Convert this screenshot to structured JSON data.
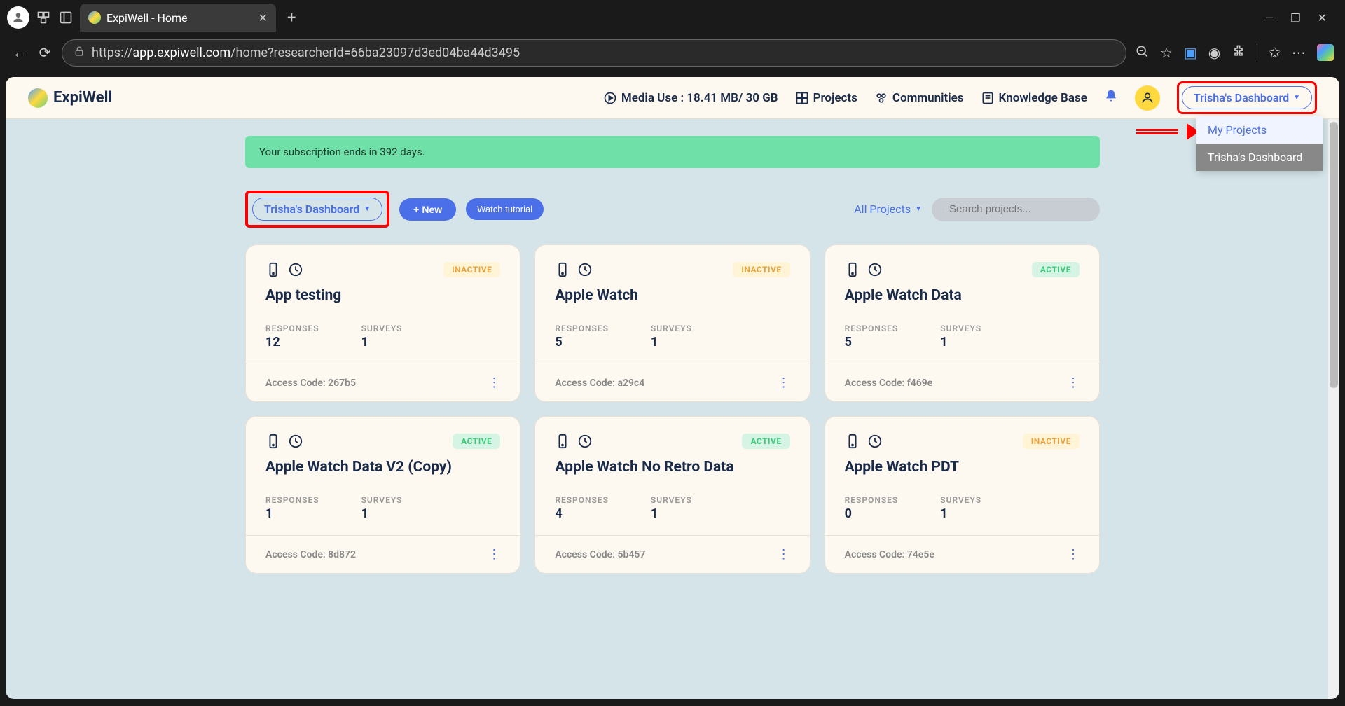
{
  "browser": {
    "tab_title": "ExpiWell - Home",
    "url_prefix": "https://",
    "url_domain": "app.expiwell.com",
    "url_path": "/home?researcherId=66ba23097d3ed04ba44d3495"
  },
  "header": {
    "logo_text": "ExpiWell",
    "media_use": "Media Use : 18.41 MB/ 30 GB",
    "nav_projects": "Projects",
    "nav_communities": "Communities",
    "nav_knowledge": "Knowledge Base",
    "dashboard_label": "Trisha's Dashboard"
  },
  "dropdown": {
    "item_myprojects": "My Projects",
    "item_dashboard": "Trisha's Dashboard"
  },
  "banner": {
    "subscription_text": "Your subscription ends in 392 days."
  },
  "controls": {
    "dashboard_label": "Trisha's Dashboard",
    "new_btn": "New",
    "tutorial_btn": "Watch tutorial",
    "filter_label": "All Projects",
    "search_placeholder": "Search projects..."
  },
  "labels": {
    "responses": "RESPONSES",
    "surveys": "SURVEYS",
    "access_code_prefix": "Access Code: ",
    "status_active": "ACTIVE",
    "status_inactive": "INACTIVE"
  },
  "projects": [
    {
      "title": "App testing",
      "status": "INACTIVE",
      "responses": "12",
      "surveys": "1",
      "access_code": "267b5"
    },
    {
      "title": "Apple Watch",
      "status": "INACTIVE",
      "responses": "5",
      "surveys": "1",
      "access_code": "a29c4"
    },
    {
      "title": "Apple Watch Data",
      "status": "ACTIVE",
      "responses": "5",
      "surveys": "1",
      "access_code": "f469e"
    },
    {
      "title": "Apple Watch Data V2 (Copy)",
      "status": "ACTIVE",
      "responses": "1",
      "surveys": "1",
      "access_code": "8d872"
    },
    {
      "title": "Apple Watch No Retro Data",
      "status": "ACTIVE",
      "responses": "4",
      "surveys": "1",
      "access_code": "5b457"
    },
    {
      "title": "Apple Watch PDT",
      "status": "INACTIVE",
      "responses": "0",
      "surveys": "1",
      "access_code": "74e5e"
    }
  ]
}
